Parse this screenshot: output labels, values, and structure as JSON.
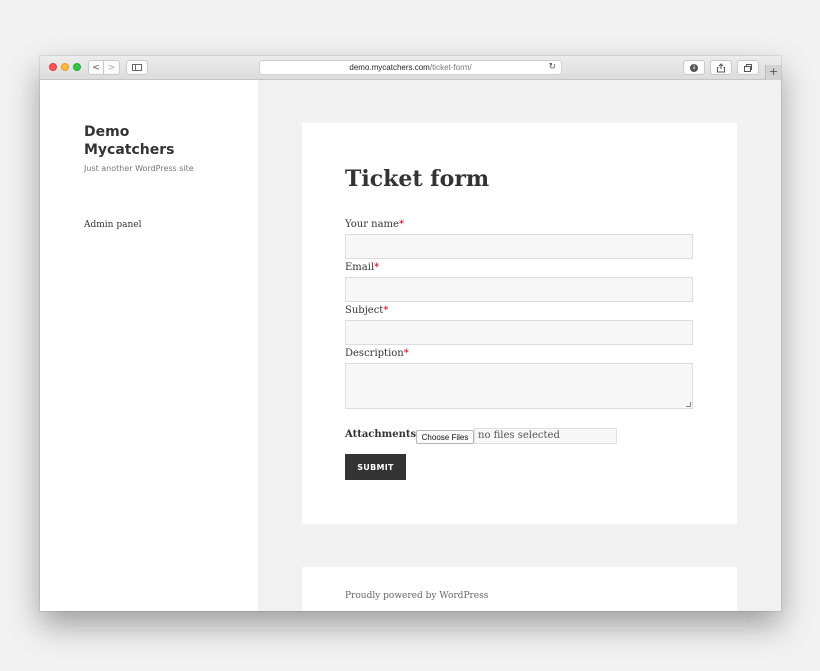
{
  "browser": {
    "url_domain": "demo.mycatchers.com",
    "url_path": "/ticket-form/",
    "nav_back": "<",
    "nav_forward": ">",
    "reload_glyph": "↻",
    "new_tab_glyph": "+",
    "icons": [
      "back-icon",
      "forward-icon",
      "sidebar-icon",
      "reload-icon",
      "download-icon",
      "share-icon",
      "tabs-icon",
      "plus-icon"
    ]
  },
  "sidebar": {
    "site_title": "Demo Mycatchers",
    "site_description": "Just another WordPress site",
    "links": [
      {
        "label": "Admin panel"
      }
    ]
  },
  "form": {
    "title": "Ticket form",
    "required_marker": "*",
    "fields": [
      {
        "label": "Your name",
        "value": ""
      },
      {
        "label": "Email",
        "value": ""
      },
      {
        "label": "Subject",
        "value": ""
      },
      {
        "label": "Description",
        "value": ""
      }
    ],
    "attachments_label": "Attachments",
    "choose_files_label": "Choose Files",
    "file_status": "no files selected",
    "submit_label": "SUBMIT"
  },
  "footer": {
    "text": "Proudly powered by WordPress"
  },
  "colors": {
    "required": "#d0021b",
    "submit_bg": "#333333",
    "page_bg": "#f1f1f1"
  }
}
